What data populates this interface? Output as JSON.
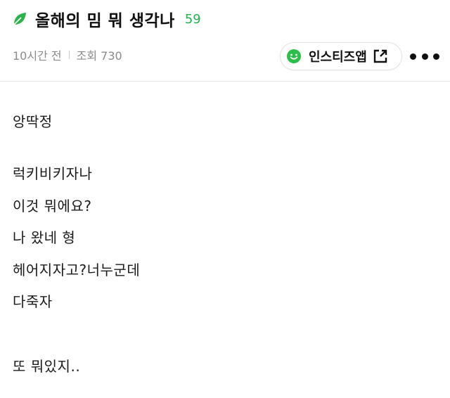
{
  "post": {
    "title": "올해의 밈 뭐 생각나",
    "comment_count": "59",
    "icon": "leaf-icon"
  },
  "meta": {
    "time": "10시간 전",
    "views": "조회 730"
  },
  "app_button": {
    "label": "인스티즈앱",
    "icon": "smile-icon",
    "trailing_icon": "external-link-icon"
  },
  "more_menu": {
    "icon": "more-dots-icon"
  },
  "content": {
    "lines": [
      "앙딱정",
      "럭키비키자나",
      "이것 뭐에요?",
      "나 왔네 형",
      "헤어지자고?너누군데",
      "다죽자",
      "또 뭐있지.."
    ]
  },
  "colors": {
    "accent_green": "#1fb34a",
    "meta_gray": "#8a8a8a",
    "divider": "#e6e6e6"
  }
}
